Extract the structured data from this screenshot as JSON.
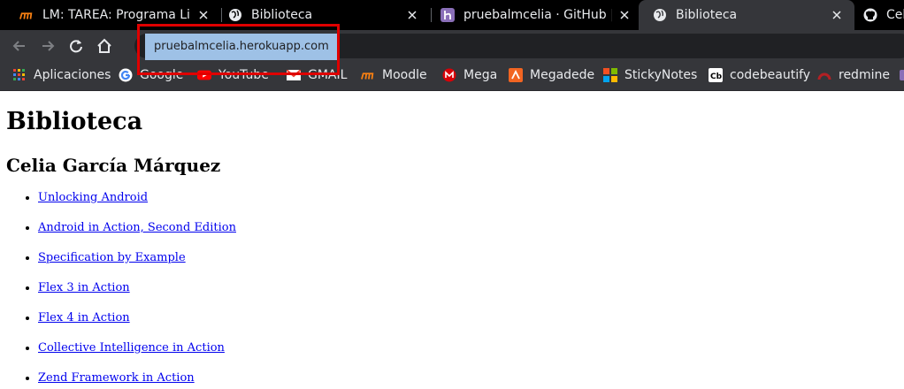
{
  "tabs": [
    {
      "title": "LM: TAREA: Programa Libre",
      "icon": "moodle-icon",
      "active": false
    },
    {
      "title": "Biblioteca",
      "icon": "globe-icon",
      "active": false
    },
    {
      "title": "pruebalmcelia · GitHub | He",
      "icon": "heroku-icon",
      "active": false
    },
    {
      "title": "Biblioteca",
      "icon": "globe-icon",
      "active": true
    },
    {
      "title": "Celi",
      "icon": "github-icon",
      "active": false
    }
  ],
  "toolbar": {
    "omnibox_suggestion": "pruebalmcelia.herokuapp.com"
  },
  "bookmarks": [
    {
      "label": "Aplicaciones",
      "icon": "apps-grid-icon"
    },
    {
      "label": "Google",
      "icon": "google-icon"
    },
    {
      "label": "YouTube",
      "icon": "youtube-icon"
    },
    {
      "label": "GMAIL",
      "icon": "gmail-icon"
    },
    {
      "label": "Moodle",
      "icon": "moodle-icon"
    },
    {
      "label": "Mega",
      "icon": "mega-icon"
    },
    {
      "label": "Megadede",
      "icon": "megadede-icon"
    },
    {
      "label": "StickyNotes",
      "icon": "stickynotes-icon"
    },
    {
      "label": "codebeautify",
      "icon": "codebeautify-icon"
    },
    {
      "label": "redmine",
      "icon": "redmine-icon"
    }
  ],
  "page": {
    "title": "Biblioteca",
    "author": "Celia García Márquez",
    "books": [
      "Unlocking Android",
      "Android in Action, Second Edition",
      "Specification by Example",
      "Flex 3 in Action",
      "Flex 4 in Action",
      "Collective Intelligence in Action",
      "Zend Framework in Action"
    ]
  },
  "colors": {
    "tabstrip": "#000000",
    "toolbar": "#35363a",
    "highlight_border": "#e00000",
    "link": "#0000ee"
  }
}
